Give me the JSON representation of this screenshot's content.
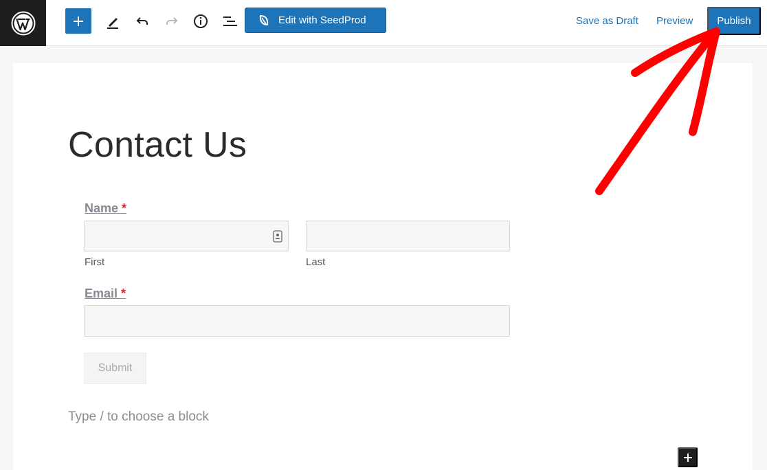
{
  "toolbar": {
    "seedprod_label": "Edit with SeedProd",
    "save_draft_label": "Save as Draft",
    "preview_label": "Preview",
    "publish_label": "Publish"
  },
  "icons": {
    "logo": "wordpress-logo",
    "inserter": "plus-icon",
    "tools": "pencil-icon",
    "undo": "undo-icon",
    "redo": "redo-icon",
    "details": "info-icon",
    "outline": "list-view-icon",
    "seedprod": "seedprod-leaf-icon",
    "contact_card": "contact-card-icon",
    "block_inserter": "plus-icon"
  },
  "colors": {
    "accent": "#1e74b8",
    "link": "#2271b1",
    "required": "#e0202a",
    "annotation_arrow": "#ff0000"
  },
  "page": {
    "title": "Contact Us",
    "block_prompt": "Type / to choose a block"
  },
  "form": {
    "name_label": "Name",
    "required_mark": "*",
    "first_sublabel": "First",
    "last_sublabel": "Last",
    "email_label": "Email",
    "first_value": "",
    "last_value": "",
    "email_value": "",
    "submit_label": "Submit"
  }
}
